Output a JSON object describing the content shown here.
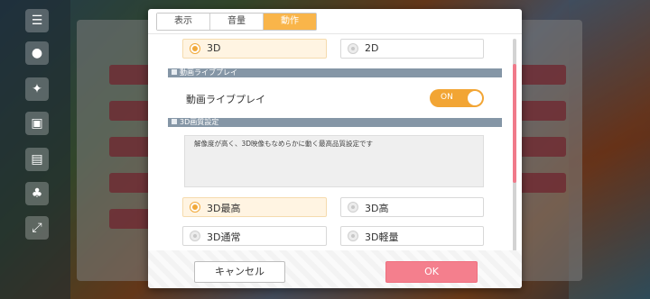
{
  "tabs": [
    {
      "label": "表示"
    },
    {
      "label": "音量"
    },
    {
      "label": "動作"
    }
  ],
  "active_tab": "動作",
  "render_mode": {
    "options": [
      {
        "label": "3D",
        "selected": true
      },
      {
        "label": "2D",
        "selected": false
      }
    ]
  },
  "live_play_section": {
    "header": "動画ライブプレイ",
    "row_label": "動画ライブプレイ",
    "toggle_text": "ON"
  },
  "quality_section": {
    "header": "3D画質設定",
    "description": "解像度が高く、3D映像もなめらかに動く最高品質設定です",
    "options": [
      {
        "label": "3D最高",
        "selected": true
      },
      {
        "label": "3D高",
        "selected": false
      },
      {
        "label": "3D通常",
        "selected": false
      },
      {
        "label": "3D軽量",
        "selected": false
      }
    ]
  },
  "footer": {
    "cancel_label": "キャンセル",
    "ok_label": "OK"
  },
  "colors": {
    "accent": "#f9b54a",
    "ok_button": "#f47f8d",
    "section_header": "#8596a6",
    "scroll_thumb": "#f07a8a"
  },
  "icons": [
    "menu-icon",
    "chat-icon",
    "gift-icon",
    "shop-icon",
    "message-icon",
    "group-icon",
    "fullscreen-icon"
  ]
}
